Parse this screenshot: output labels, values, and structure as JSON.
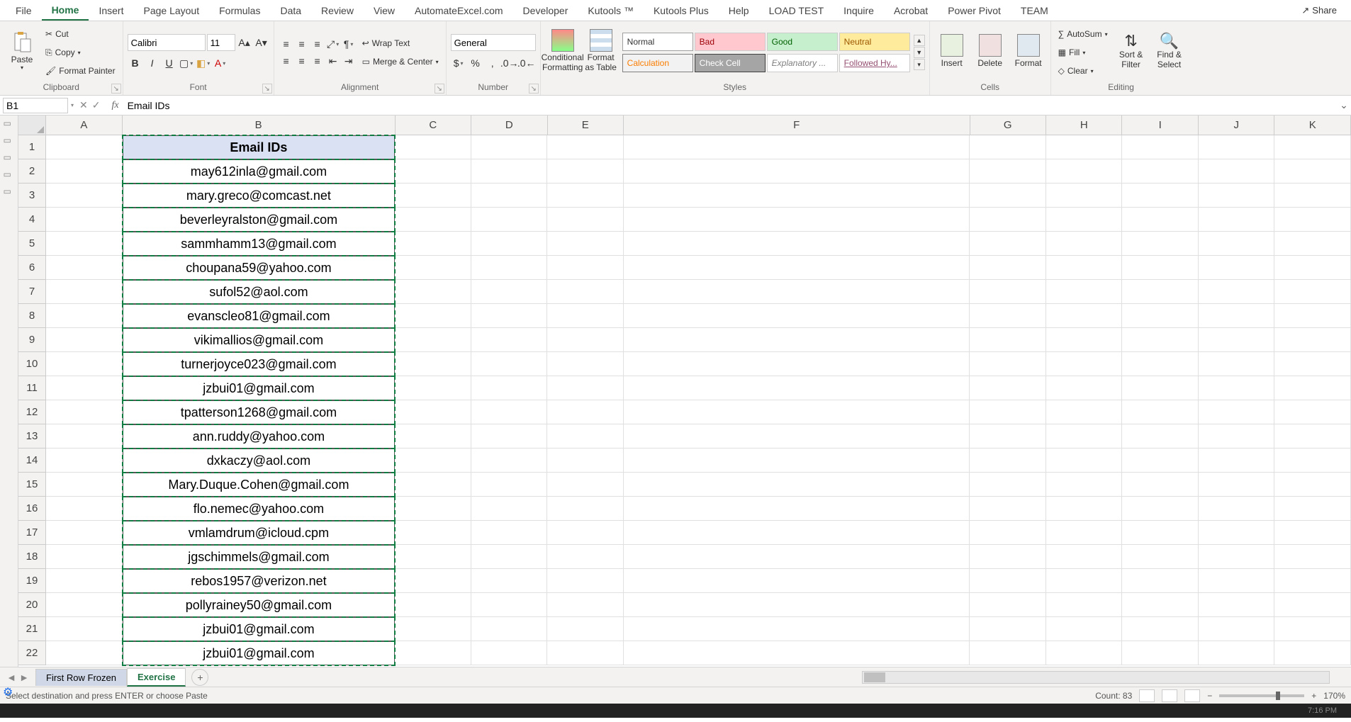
{
  "tabs": {
    "file": "File",
    "home": "Home",
    "insert": "Insert",
    "pagelayout": "Page Layout",
    "formulas": "Formulas",
    "data": "Data",
    "review": "Review",
    "view": "View",
    "automate": "AutomateExcel.com",
    "developer": "Developer",
    "kutools": "Kutools ™",
    "kutoolsplus": "Kutools Plus",
    "help": "Help",
    "loadtest": "LOAD TEST",
    "inquire": "Inquire",
    "acrobat": "Acrobat",
    "powerpivot": "Power Pivot",
    "team": "TEAM",
    "share": "Share"
  },
  "ribbon": {
    "clipboard": {
      "label": "Clipboard",
      "paste": "Paste",
      "cut": "Cut",
      "copy": "Copy",
      "formatpainter": "Format Painter"
    },
    "font": {
      "label": "Font",
      "name": "Calibri",
      "size": "11"
    },
    "alignment": {
      "label": "Alignment",
      "wrap": "Wrap Text",
      "merge": "Merge & Center"
    },
    "number": {
      "label": "Number",
      "format": "General"
    },
    "styles": {
      "label": "Styles",
      "cond": "Conditional Formatting",
      "table": "Format as Table",
      "normal": "Normal",
      "bad": "Bad",
      "good": "Good",
      "neutral": "Neutral",
      "calc": "Calculation",
      "check": "Check Cell",
      "explan": "Explanatory ...",
      "followed": "Followed Hy..."
    },
    "cells": {
      "label": "Cells",
      "insert": "Insert",
      "delete": "Delete",
      "format": "Format"
    },
    "editing": {
      "label": "Editing",
      "autosum": "AutoSum",
      "fill": "Fill",
      "clear": "Clear",
      "sort": "Sort & Filter",
      "find": "Find & Select"
    }
  },
  "namebox": "B1",
  "formula": "Email IDs",
  "columns": [
    "A",
    "B",
    "C",
    "D",
    "E",
    "F",
    "G",
    "H",
    "I",
    "J",
    "K"
  ],
  "header_cell": "Email IDs",
  "emails": [
    "may612inla@gmail.com",
    "mary.greco@comcast.net",
    "beverleyralston@gmail.com",
    "sammhamm13@gmail.com",
    "choupana59@yahoo.com",
    "sufol52@aol.com",
    "evanscleo81@gmail.com",
    "vikimallios@gmail.com",
    "turnerjoyce023@gmail.com",
    "jzbui01@gmail.com",
    "tpatterson1268@gmail.com",
    "ann.ruddy@yahoo.com",
    "dxkaczy@aol.com",
    "Mary.Duque.Cohen@gmail.com",
    "flo.nemec@yahoo.com",
    "vmlamdrum@icloud.cpm",
    "jgschimmels@gmail.com",
    "rebos1957@verizon.net",
    "pollyrainey50@gmail.com",
    "jzbui01@gmail.com",
    "jzbui01@gmail.com"
  ],
  "sheets": {
    "s1": "First Row Frozen",
    "s2": "Exercise"
  },
  "status": {
    "msg": "Select destination and press ENTER or choose Paste",
    "count": "Count: 83",
    "zoom": "170%"
  },
  "time": "7:16 PM"
}
